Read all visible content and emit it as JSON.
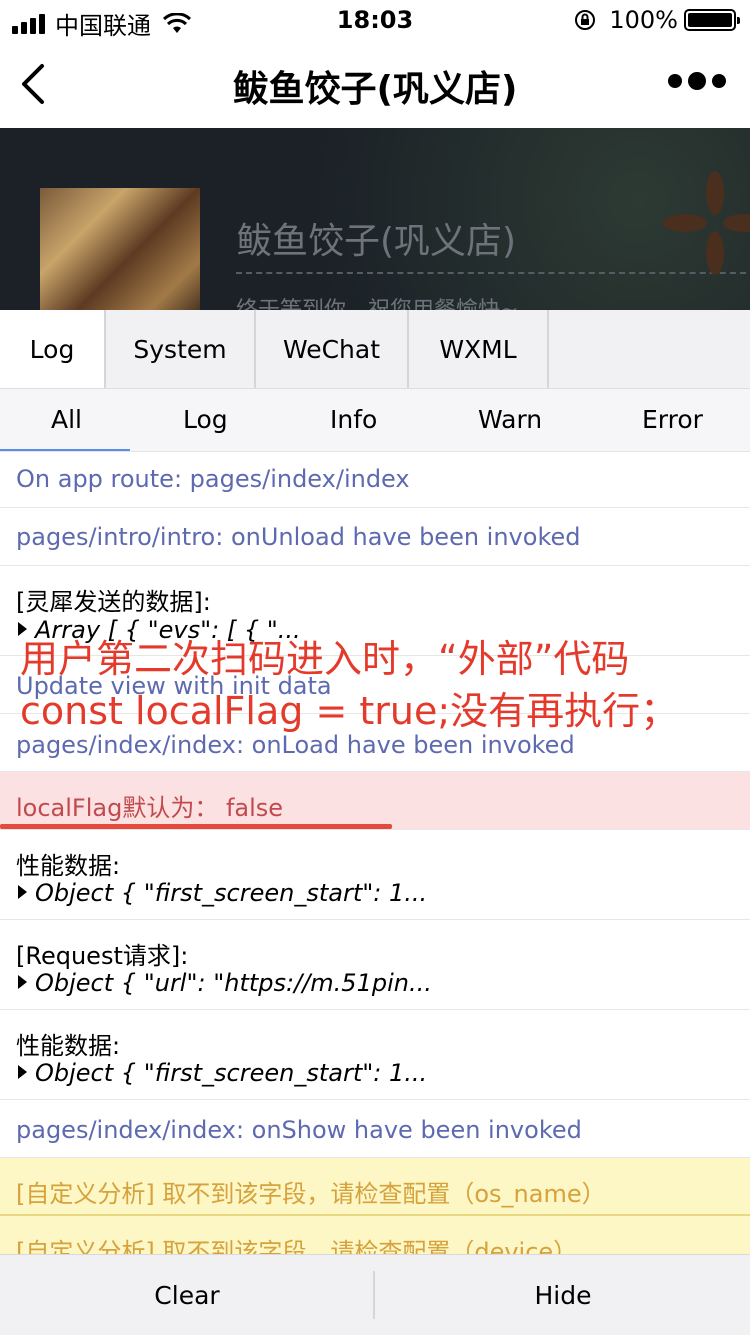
{
  "status_bar": {
    "carrier": "中国联通",
    "time": "18:03",
    "battery": "100%"
  },
  "nav": {
    "title": "鲅鱼饺子(巩义店)"
  },
  "hero": {
    "title": "鲅鱼饺子(巩义店)",
    "subtitle": "终于等到你，祝您用餐愉快~"
  },
  "tabs": [
    "Log",
    "System",
    "WeChat",
    "WXML"
  ],
  "filters": [
    "All",
    "Log",
    "Info",
    "Warn",
    "Error"
  ],
  "logs": {
    "r1": "On app route: pages/index/index",
    "r2": "pages/intro/intro: onUnload have been invoked",
    "r3_label": "[灵犀发送的数据]:",
    "r3_obj": "Array [ { \"evs\": [ { \"...",
    "r4": "Update view with init data",
    "r5": "pages/index/index: onLoad have been invoked",
    "r6": "localFlag默认为：  false",
    "r7_label": "性能数据:",
    "r7_obj": "Object { \"first_screen_start\": 1...",
    "r8_label": "[Request请求]:",
    "r8_obj": "Object { \"url\": \"https://m.51pin...",
    "r9_label": "性能数据:",
    "r9_obj": "Object { \"first_screen_start\": 1...",
    "r10": "pages/index/index: onShow have been invoked",
    "r11": "[自定义分析] 取不到该字段，请检查配置（os_name）",
    "r12": "[自定义分析] 取不到该字段，请检查配置（device）"
  },
  "annotation": {
    "line1": "用户第二次扫码进入时，“外部”代码",
    "line2": "const localFlag = true;没有再执行；"
  },
  "bottom": {
    "clear": "Clear",
    "hide": "Hide"
  }
}
